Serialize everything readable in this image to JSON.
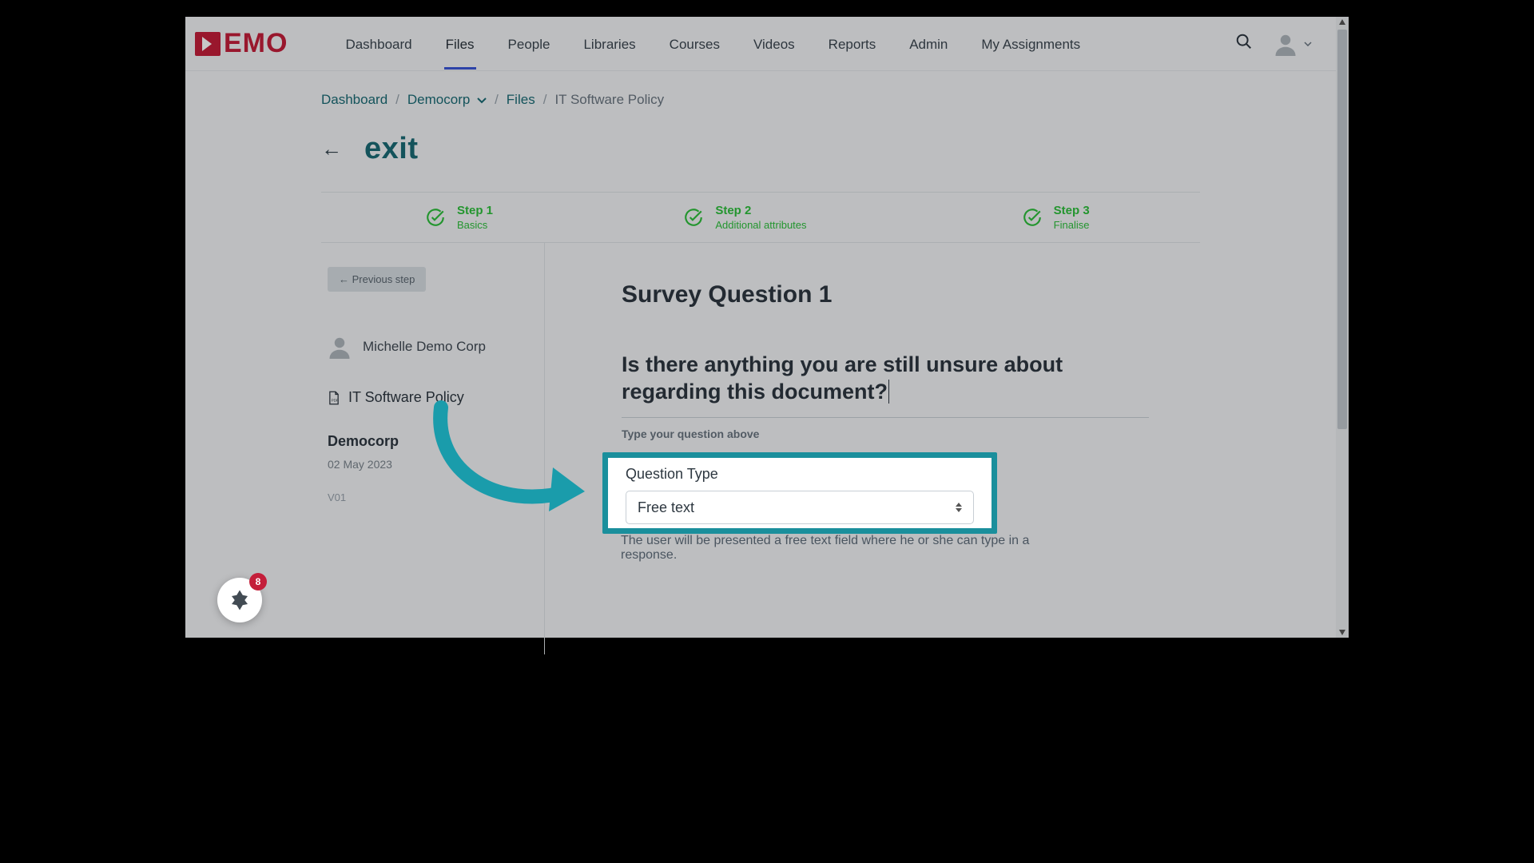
{
  "logo_text": "EMO",
  "nav": {
    "items": [
      "Dashboard",
      "Files",
      "People",
      "Libraries",
      "Courses",
      "Videos",
      "Reports",
      "Admin",
      "My Assignments"
    ],
    "active_index": 1
  },
  "breadcrumb": {
    "dashboard": "Dashboard",
    "org": "Democorp",
    "files": "Files",
    "current": "IT Software Policy"
  },
  "exit_label": "exit",
  "steps": [
    {
      "title": "Step 1",
      "subtitle": "Basics"
    },
    {
      "title": "Step 2",
      "subtitle": "Additional attributes"
    },
    {
      "title": "Step 3",
      "subtitle": "Finalise"
    }
  ],
  "left": {
    "prev_button": "← Previous step",
    "owner_name": "Michelle Demo Corp",
    "doc_name": "IT Software Policy",
    "org": "Democorp",
    "date": "02 May 2023",
    "version": "V01"
  },
  "main": {
    "question_heading": "Survey Question 1",
    "question_text": "Is there anything you are still unsure about regarding this document?",
    "helper": "Type your question above",
    "qt_label": "Question Type",
    "qt_value": "Free text",
    "qt_desc": "The user will be presented a free text field where he or she can type in a response."
  },
  "widget": {
    "badge": "8"
  }
}
